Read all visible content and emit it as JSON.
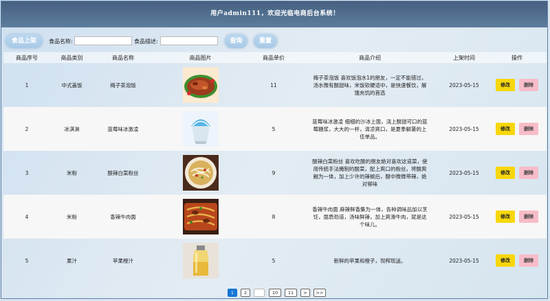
{
  "header": {
    "title": "用户admin111，欢迎光临电商后台系统！"
  },
  "toolbar": {
    "add_label": "食品上架",
    "name_label": "食品名称:",
    "name_value": "",
    "desc_label": "食品描述:",
    "desc_value": "",
    "search_label": "查询",
    "reset_label": "重置"
  },
  "table": {
    "columns": [
      "商品序号",
      "商品类别",
      "商品名称",
      "商品图片",
      "商品单价",
      "商品介绍",
      "上架时间",
      "操作"
    ],
    "edit_label": "修改",
    "delete_label": "删除",
    "rows": [
      {
        "id": "1",
        "category": "中式盖饭",
        "name": "梅子茶泡饭",
        "image": "dish-image",
        "price": "11",
        "desc": "梅子茶泡饭 喜欢饭泡水1的朋友，一定不能错过，汤水微有酸甜味，米饭软硬适中，是快速餐饮，解饿充饥的首选",
        "date": "2023-05-15"
      },
      {
        "id": "2",
        "category": "冰淇淋",
        "name": "蓝莓味冰激凌",
        "image": "shaved-ice-image",
        "price": "5",
        "desc": "蓝莓味冰激凌 细细的沙冰上面，浇上酸甜可口的蓝莓糖浆，大大的一杯，清凉爽口，是夏季解暑的上佳单品。",
        "date": "2023-05-15"
      },
      {
        "id": "3",
        "category": "米粉",
        "name": "酸辣白菜粉丝",
        "image": "noodle-bowl-image",
        "price": "9",
        "desc": "酸辣白菜粉丝 喜欢吃酸的朋友绝对喜欢这道菜，使用传统手法腌制的酸菜，配上爽口的粉丝，将酸爽融为一体，加上少许的辣椒后，酸中微微带辣，绝对够味",
        "date": "2023-05-15"
      },
      {
        "id": "4",
        "category": "米粉",
        "name": "香辣牛肉面",
        "image": "beef-noodle-image",
        "price": "8",
        "desc": "香辣牛肉面 麻辣鲜香集为一体，各种调味品加以烹饪，面质劲道，汤味鲜辣，加上爽滑牛肉，就是这个味儿。",
        "date": "2023-05-15"
      },
      {
        "id": "5",
        "category": "果汁",
        "name": "苹果橙汁",
        "image": "juice-bottle-image",
        "price": "5",
        "desc": "新鲜的苹果和橙子，现榨现送。",
        "date": "2023-05-15"
      }
    ]
  },
  "pager": {
    "items": [
      "1",
      "2",
      "",
      "10",
      "11",
      ">",
      ">>"
    ]
  }
}
